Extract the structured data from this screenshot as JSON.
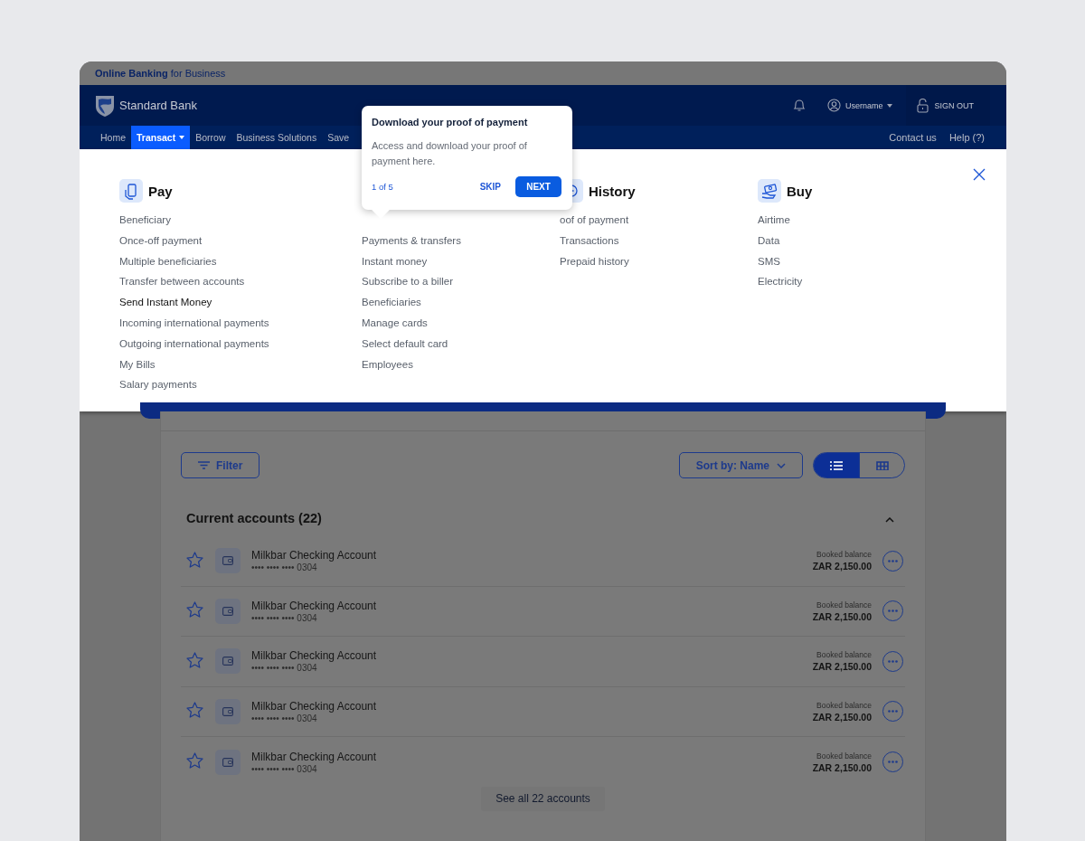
{
  "top_strip": {
    "text": "**Online Banking** for Business"
  },
  "header": {
    "brand": "Standard Bank",
    "username": "Username",
    "sign_out": "SIGN OUT"
  },
  "nav": {
    "items": [
      {
        "label": "Home",
        "selected": false,
        "dropdown": false
      },
      {
        "label": "Transact",
        "selected": true,
        "dropdown": true
      },
      {
        "label": "Borrow",
        "selected": false,
        "dropdown": false
      },
      {
        "label": "Business Solutions",
        "selected": false,
        "dropdown": false
      },
      {
        "label": "Save",
        "selected": false,
        "dropdown": false
      }
    ],
    "links": [
      "Contact us",
      "Help (?)"
    ]
  },
  "mega_menu": {
    "columns": [
      {
        "kind": "pay",
        "heading": "Pay",
        "items": [
          {
            "label": "Beneficiary",
            "highlighted": false
          },
          {
            "label": "Once-off payment",
            "highlighted": false
          },
          {
            "label": "Multiple beneficiaries",
            "highlighted": false
          },
          {
            "label": "Transfer between accounts",
            "highlighted": false
          },
          {
            "label": "Send Instant Money",
            "highlighted": true
          },
          {
            "label": "Incoming international payments",
            "highlighted": false
          },
          {
            "label": "Outgoing international payments",
            "highlighted": false
          },
          {
            "label": "My Bills",
            "highlighted": false
          },
          {
            "label": "Salary payments",
            "highlighted": false
          }
        ]
      },
      {
        "items": [
          {
            "label": "Payments & transfers",
            "highlighted": false
          },
          {
            "label": "Instant money",
            "highlighted": false
          },
          {
            "label": "Subscribe to a biller",
            "highlighted": false
          },
          {
            "label": "Beneficiaries",
            "highlighted": false
          },
          {
            "label": "Manage cards",
            "highlighted": false
          },
          {
            "label": "Select default card",
            "highlighted": false
          },
          {
            "label": "Employees",
            "highlighted": false
          }
        ]
      },
      {
        "kind": "history",
        "heading": "History",
        "items": [
          {
            "label": "oof of payment",
            "highlighted": false
          },
          {
            "label": "Transactions",
            "highlighted": false
          },
          {
            "label": "Prepaid history",
            "highlighted": false
          }
        ]
      },
      {
        "kind": "buy",
        "heading": "Buy",
        "items": [
          {
            "label": "Airtime",
            "highlighted": false
          },
          {
            "label": "Data",
            "highlighted": false
          },
          {
            "label": "SMS",
            "highlighted": false
          },
          {
            "label": "Electricity",
            "highlighted": false
          }
        ]
      }
    ]
  },
  "tooltip": {
    "title": "Download your proof of payment",
    "body": "Access and download your proof of payment here.",
    "step": "1 of 5",
    "skip": "SKIP",
    "next": "NEXT"
  },
  "accounts": {
    "filter": "Filter",
    "sort": "Sort by: Name",
    "views": [
      {
        "kind": "list",
        "selected": true
      },
      {
        "kind": "grid",
        "selected": false
      }
    ],
    "section_title": "Current accounts (22)",
    "rows": [
      {
        "name": "Milkbar Checking Account",
        "number": "•••• •••• •••• 0304",
        "balance_label": "Booked balance",
        "balance": "ZAR 2,150.00"
      },
      {
        "name": "Milkbar Checking Account",
        "number": "•••• •••• •••• 0304",
        "balance_label": "Booked balance",
        "balance": "ZAR 2,150.00"
      },
      {
        "name": "Milkbar Checking Account",
        "number": "•••• •••• •••• 0304",
        "balance_label": "Booked balance",
        "balance": "ZAR 2,150.00"
      },
      {
        "name": "Milkbar Checking Account",
        "number": "•••• •••• •••• 0304",
        "balance_label": "Booked balance",
        "balance": "ZAR 2,150.00"
      },
      {
        "name": "Milkbar Checking Account",
        "number": "•••• •••• •••• 0304",
        "balance_label": "Booked balance",
        "balance": "ZAR 2,150.00"
      }
    ],
    "see_all": "See all 22 accounts"
  }
}
